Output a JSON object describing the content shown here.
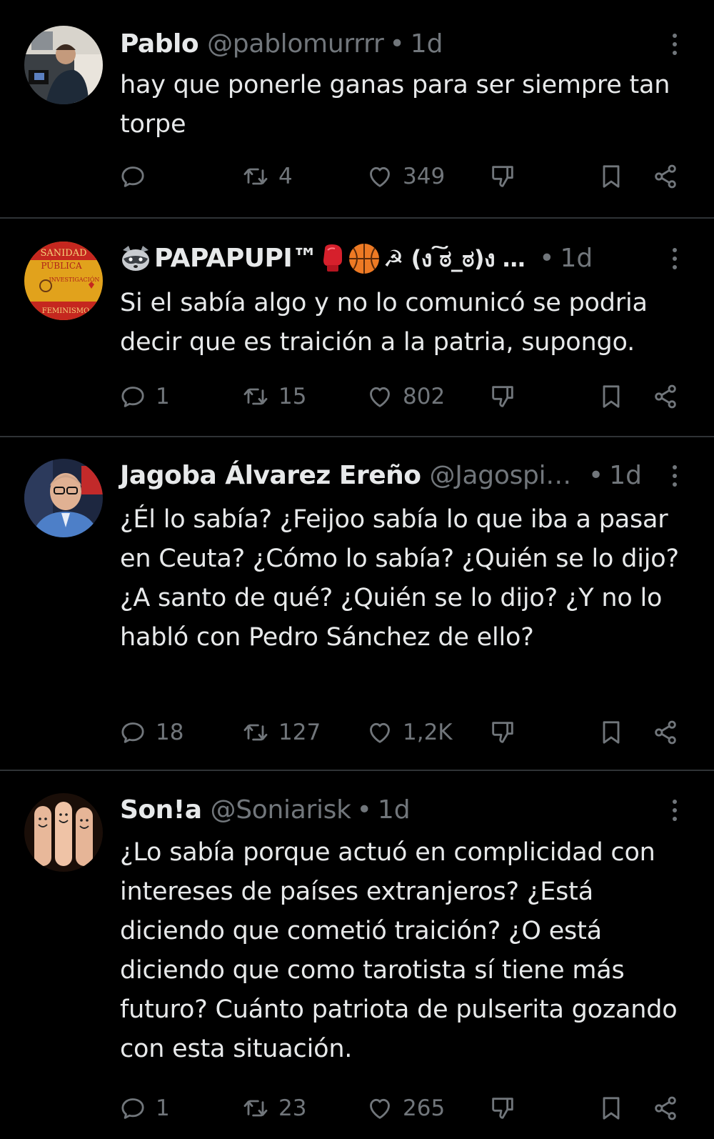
{
  "tweets": [
    {
      "name": "Pablo",
      "handle": "@pablomurrrr",
      "dot": "•",
      "time": "1d",
      "text": "hay que ponerle ganas para ser siempre tan torpe",
      "replies": "",
      "retweets": "4",
      "likes": "349"
    },
    {
      "name_part1": "PAPAPUPI™",
      "name_part2": "☭ (ง ͠ಠ_ಠ)ง …",
      "dot": "•",
      "time": "1d",
      "text": "Si el sabía algo y no lo comunicó se podria decir que es traición a la patria, supongo.",
      "replies": "1",
      "retweets": "15",
      "likes": "802",
      "avatar_text": [
        "SANIDAD",
        "PÚBLICA",
        "INVESTIGACIÓN",
        "FEMINISMO"
      ]
    },
    {
      "name": "Jagoba Álvarez Ereño",
      "handle": "@Jagospi…",
      "dot": "•",
      "time": "1d",
      "text": "¿Él lo sabía? ¿Feijoo sabía lo que iba a pasar en Ceuta? ¿Cómo lo sabía? ¿Quién se lo dijo? ¿A santo de qué? ¿Quién se lo dijo? ¿Y no lo habló con Pedro Sánchez de ello?",
      "replies": "18",
      "retweets": "127",
      "likes": "1,2K"
    },
    {
      "name": "Son!a",
      "handle": "@Soniarisk",
      "dot": "•",
      "time": "1d",
      "text": "¿Lo sabía porque actuó en complicidad con intereses de países extranjeros? ¿Está diciendo que cometió traición? ¿O está diciendo que como tarotista sí tiene más futuro? Cuánto patriota de pulserita gozando con esta situación.",
      "replies": "1",
      "retweets": "23",
      "likes": "265"
    }
  ],
  "colors": {
    "background": "#000000",
    "text": "#e7e9ea",
    "secondary": "#71767b",
    "divider": "#2f3336"
  },
  "icons": [
    "reply-icon",
    "retweet-icon",
    "like-icon",
    "dislike-icon",
    "bookmark-icon",
    "share-icon",
    "more-icon"
  ]
}
